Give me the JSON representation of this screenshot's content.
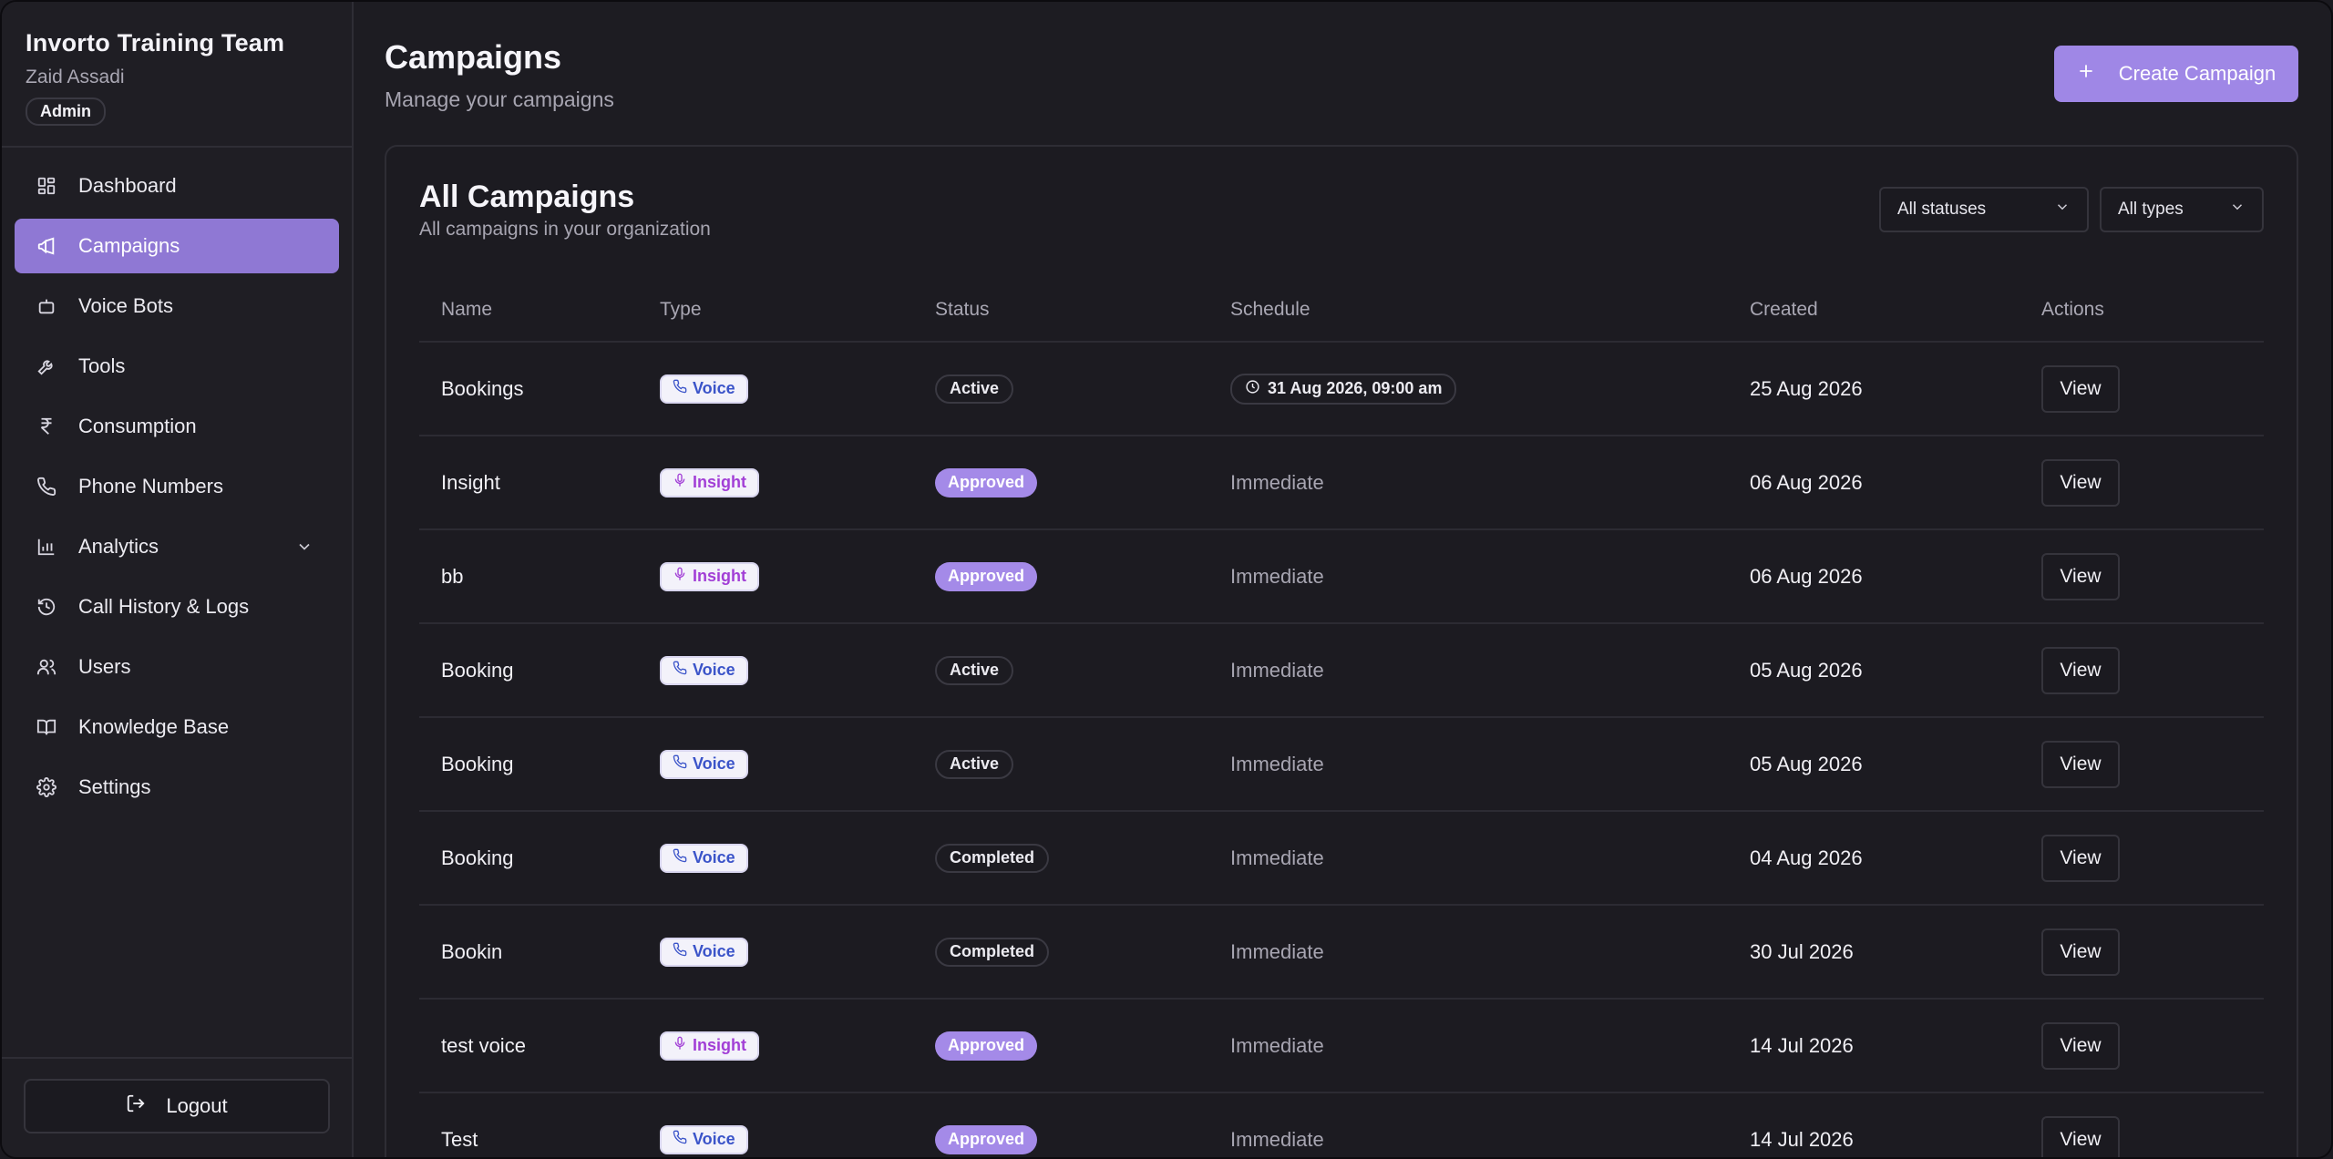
{
  "org": {
    "name": "Invorto Training Team",
    "user": "Zaid Assadi",
    "role": "Admin"
  },
  "nav": [
    {
      "label": "Dashboard",
      "icon": "dashboard-icon",
      "active": false
    },
    {
      "label": "Campaigns",
      "icon": "megaphone-icon",
      "active": true
    },
    {
      "label": "Voice Bots",
      "icon": "bot-icon",
      "active": false
    },
    {
      "label": "Tools",
      "icon": "wrench-icon",
      "active": false
    },
    {
      "label": "Consumption",
      "icon": "rupee-icon",
      "active": false
    },
    {
      "label": "Phone Numbers",
      "icon": "phone-icon",
      "active": false
    },
    {
      "label": "Analytics",
      "icon": "bar-chart-icon",
      "active": false,
      "expandable": true
    },
    {
      "label": "Call History & Logs",
      "icon": "history-icon",
      "active": false
    },
    {
      "label": "Users",
      "icon": "users-icon",
      "active": false
    },
    {
      "label": "Knowledge Base",
      "icon": "book-icon",
      "active": false
    },
    {
      "label": "Settings",
      "icon": "gear-icon",
      "active": false
    }
  ],
  "logout_label": "Logout",
  "header": {
    "title": "Campaigns",
    "subtitle": "Manage your campaigns",
    "create_label": "Create Campaign"
  },
  "card": {
    "title": "All Campaigns",
    "subtitle": "All campaigns in your organization",
    "filter_status": "All statuses",
    "filter_type": "All types"
  },
  "table": {
    "columns": [
      "Name",
      "Type",
      "Status",
      "Schedule",
      "Created",
      "Actions"
    ],
    "view_label": "View",
    "rows": [
      {
        "name": "Bookings",
        "type": "Voice",
        "status": "Active",
        "schedule": "31 Aug 2026, 09:00 am",
        "scheduled": true,
        "created": "25 Aug 2026"
      },
      {
        "name": "Insight",
        "type": "Insight",
        "status": "Approved",
        "schedule": "Immediate",
        "scheduled": false,
        "created": "06 Aug 2026"
      },
      {
        "name": "bb",
        "type": "Insight",
        "status": "Approved",
        "schedule": "Immediate",
        "scheduled": false,
        "created": "06 Aug 2026"
      },
      {
        "name": "Booking",
        "type": "Voice",
        "status": "Active",
        "schedule": "Immediate",
        "scheduled": false,
        "created": "05 Aug 2026"
      },
      {
        "name": "Booking",
        "type": "Voice",
        "status": "Active",
        "schedule": "Immediate",
        "scheduled": false,
        "created": "05 Aug 2026"
      },
      {
        "name": "Booking",
        "type": "Voice",
        "status": "Completed",
        "schedule": "Immediate",
        "scheduled": false,
        "created": "04 Aug 2026"
      },
      {
        "name": "Bookin",
        "type": "Voice",
        "status": "Completed",
        "schedule": "Immediate",
        "scheduled": false,
        "created": "30 Jul 2026"
      },
      {
        "name": "test voice",
        "type": "Insight",
        "status": "Approved",
        "schedule": "Immediate",
        "scheduled": false,
        "created": "14 Jul 2026"
      },
      {
        "name": "Test",
        "type": "Voice",
        "status": "Approved",
        "schedule": "Immediate",
        "scheduled": false,
        "created": "14 Jul 2026"
      }
    ]
  },
  "colors": {
    "accent": "#9f87e6",
    "active_nav": "#8f78d4",
    "voice_text": "#3b54c9",
    "insight_text": "#a23fd6"
  }
}
